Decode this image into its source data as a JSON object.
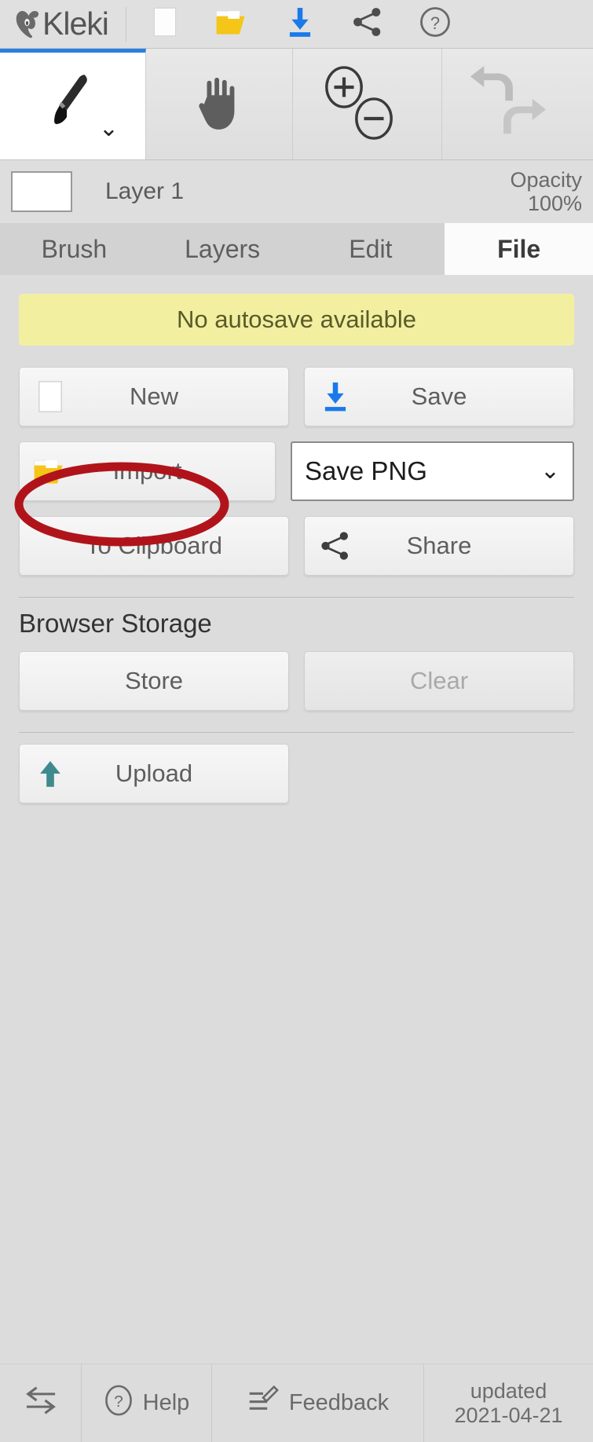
{
  "app": {
    "name": "Kleki",
    "accent_blue": "#2b7fe0",
    "panel_bg": "#dcdcdc",
    "annotation_color": "#b0141a"
  },
  "topbar": {
    "logo_text": "Kleki",
    "buttons": [
      {
        "name": "new-document",
        "icon": "page-icon"
      },
      {
        "name": "import",
        "icon": "folder-icon"
      },
      {
        "name": "save",
        "icon": "download-icon"
      },
      {
        "name": "share",
        "icon": "share-icon"
      },
      {
        "name": "help",
        "icon": "question-circle-icon"
      }
    ]
  },
  "toolbar": {
    "tools": [
      {
        "name": "brush-tool",
        "icon": "brush-icon",
        "active": true,
        "caret": "⌄"
      },
      {
        "name": "hand-tool",
        "icon": "hand-icon",
        "active": false
      },
      {
        "name": "zoom-in",
        "icon": "zoom-in-icon",
        "active": false
      },
      {
        "name": "zoom-out",
        "icon": "zoom-out-icon",
        "active": false
      },
      {
        "name": "undo",
        "icon": "undo-icon",
        "disabled": true
      },
      {
        "name": "redo",
        "icon": "redo-icon",
        "disabled": true
      }
    ]
  },
  "layer": {
    "name": "Layer 1",
    "opacity_label": "Opacity",
    "opacity_value": "100%"
  },
  "tabs": [
    {
      "label": "Brush",
      "active": false
    },
    {
      "label": "Layers",
      "active": false
    },
    {
      "label": "Edit",
      "active": false
    },
    {
      "label": "File",
      "active": true
    }
  ],
  "file_panel": {
    "autosave_message": "No autosave available",
    "new_label": "New",
    "save_label": "Save",
    "import_label": "Import",
    "format_select_value": "Save PNG",
    "format_select_caret": "⌄",
    "to_clipboard_label": "To Clipboard",
    "share_label": "Share",
    "browser_storage_title": "Browser Storage",
    "store_label": "Store",
    "clear_label": "Clear",
    "upload_label": "Upload"
  },
  "footer": {
    "swap_icon": "swap-arrows-icon",
    "help_label": "Help",
    "feedback_label": "Feedback",
    "updated_label": "updated",
    "updated_date": "2021-04-21"
  }
}
